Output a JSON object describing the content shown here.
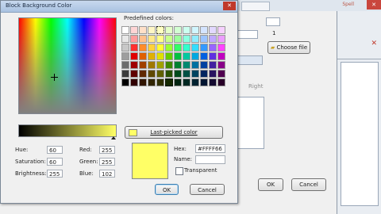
{
  "dialog": {
    "title": "Block Background Color",
    "predefined_label": "Predefined colors:",
    "last_picked_label": "Last-picked color",
    "fields": {
      "hue": {
        "label": "Hue:",
        "value": "60"
      },
      "saturation": {
        "label": "Saturation:",
        "value": "60"
      },
      "brightness": {
        "label": "Brightness:",
        "value": "255"
      },
      "red": {
        "label": "Red:",
        "value": "255"
      },
      "green": {
        "label": "Green:",
        "value": "255"
      },
      "blue": {
        "label": "Blue:",
        "value": "102"
      }
    },
    "hex_label": "Hex:",
    "hex_value": "#FFFF66",
    "name_label": "Name:",
    "name_value": "",
    "transparent_label": "Transparent",
    "ok_label": "OK",
    "cancel_label": "Cancel",
    "current_color": "#ffff66",
    "swatches": [
      [
        "#ffffff",
        "#ffd5d5",
        "#ffe0c8",
        "#fff6c4",
        "#ffffc0",
        "#e4ffc8",
        "#d2ffd2",
        "#ccfff0",
        "#d0f6ff",
        "#d4e4ff",
        "#e2d8ff",
        "#f6d0ff"
      ],
      [
        "#e8e8e8",
        "#ff9c9c",
        "#ffc08c",
        "#ffe88a",
        "#ffff88",
        "#c8ff8c",
        "#9cff9c",
        "#8cffe0",
        "#90ecff",
        "#9cc4ff",
        "#c0a8ff",
        "#ec9cff"
      ],
      [
        "#c8c8c8",
        "#ff3030",
        "#ff8c2a",
        "#ffd23a",
        "#ffff33",
        "#99ff33",
        "#33ff66",
        "#33ffcc",
        "#33ddff",
        "#3399ff",
        "#9966ff",
        "#ff44ff"
      ],
      [
        "#9e9e9e",
        "#e00000",
        "#e06000",
        "#e0b000",
        "#e0e000",
        "#66cc00",
        "#00c040",
        "#00c8a0",
        "#00a8e0",
        "#0060e0",
        "#6030e0",
        "#c000c0"
      ],
      [
        "#6c6c6c",
        "#a00000",
        "#a04000",
        "#a07800",
        "#a0a000",
        "#408800",
        "#008030",
        "#008870",
        "#0070a0",
        "#0040a0",
        "#4020a0",
        "#880088"
      ],
      [
        "#3c3c3c",
        "#600000",
        "#602800",
        "#604800",
        "#606000",
        "#285000",
        "#004a1c",
        "#005044",
        "#004460",
        "#002660",
        "#281460",
        "#500050"
      ],
      [
        "#000000",
        "#300000",
        "#301400",
        "#302400",
        "#303000",
        "#142800",
        "#002410",
        "#002822",
        "#002230",
        "#001430",
        "#140a30",
        "#280028"
      ]
    ]
  },
  "background": {
    "spell_label": "Spell",
    "choose_file_label": "Choose file",
    "right_label": "Right",
    "ok_label": "OK",
    "cancel_label": "Cancel",
    "counter_value": "1"
  }
}
